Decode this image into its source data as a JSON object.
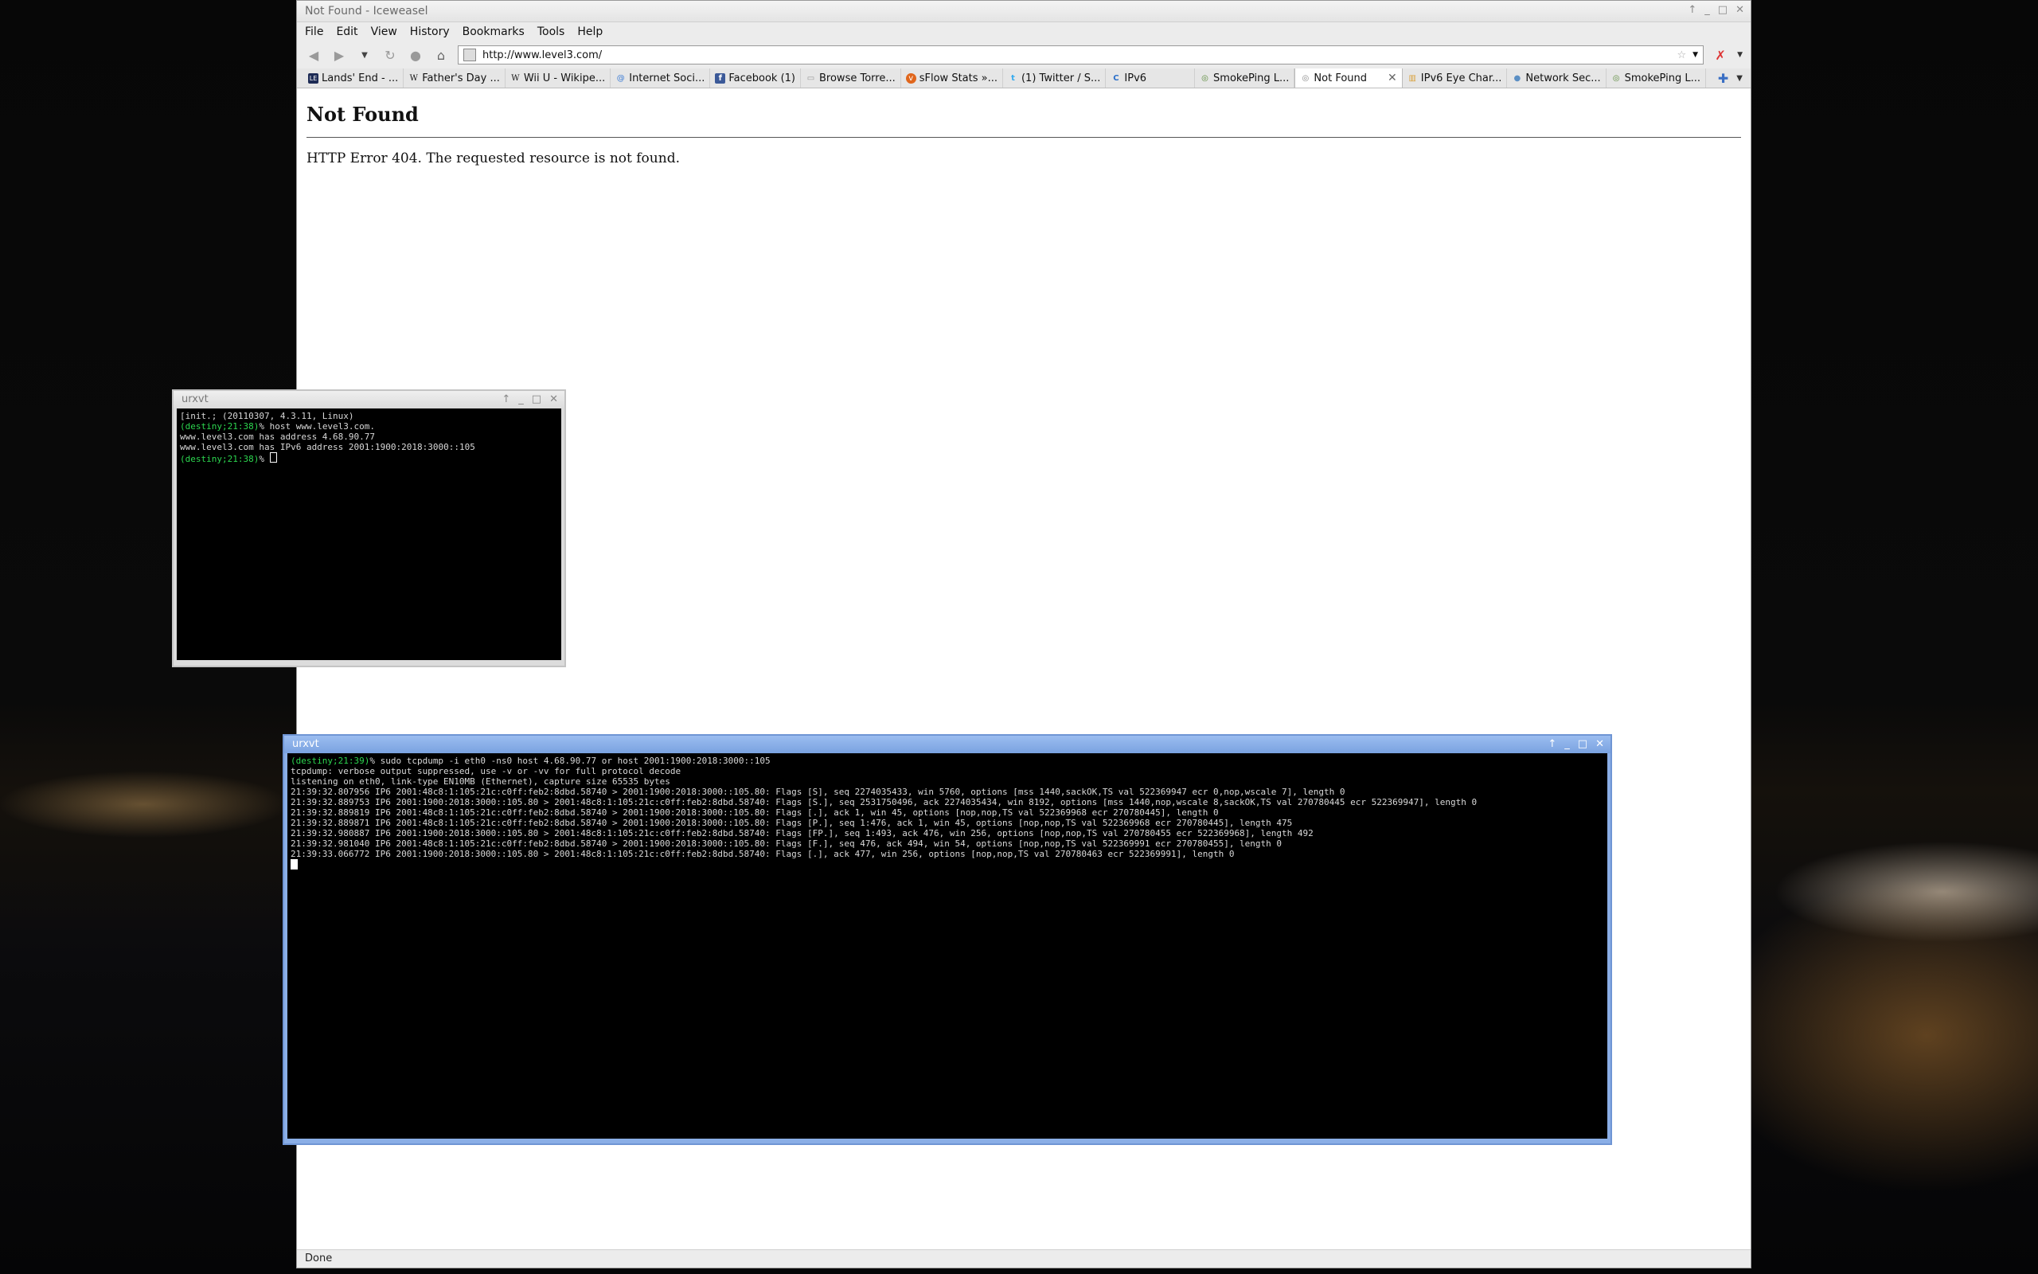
{
  "browser": {
    "window_title": "Not Found - Iceweasel",
    "window_buttons": [
      "↑",
      "_",
      "□",
      "✕"
    ],
    "menu": [
      "File",
      "Edit",
      "View",
      "History",
      "Bookmarks",
      "Tools",
      "Help"
    ],
    "url": "http://www.level3.com/",
    "tabs": [
      {
        "label": "Lands' End - ...",
        "icon": "LE",
        "icon_color": "#1d2b55"
      },
      {
        "label": "Father's Day ...",
        "icon": "W",
        "icon_color": "#ffffff"
      },
      {
        "label": "Wii U - Wikipe...",
        "icon": "W",
        "icon_color": "#ffffff"
      },
      {
        "label": "Internet Soci...",
        "icon": "@",
        "icon_color": "#3a7bd5"
      },
      {
        "label": "Facebook (1)",
        "icon": "f",
        "icon_color": "#3b5998"
      },
      {
        "label": "Browse Torre...",
        "icon": "▭",
        "icon_color": "#dddddd"
      },
      {
        "label": "sFlow Stats »...",
        "icon": "v",
        "icon_color": "#e0661c"
      },
      {
        "label": "(1) Twitter / S...",
        "icon": "t",
        "icon_color": "#33aaee"
      },
      {
        "label": "IPv6",
        "icon": "C",
        "icon_color": "#2a6fc9"
      },
      {
        "label": "SmokePing L...",
        "icon": "◎",
        "icon_color": "#cfe6c0"
      },
      {
        "label": "Not Found",
        "icon": "◎",
        "icon_color": "#dddddd",
        "active": true
      },
      {
        "label": "IPv6 Eye Char...",
        "icon": "▥",
        "icon_color": "#d9a03a"
      },
      {
        "label": "Network Sec...",
        "icon": "●",
        "icon_color": "#5b8fc4"
      },
      {
        "label": "SmokePing L...",
        "icon": "◎",
        "icon_color": "#cfe6c0"
      }
    ],
    "page": {
      "heading": "Not Found",
      "message": "HTTP Error 404. The requested resource is not found."
    },
    "status": "Done"
  },
  "term_small": {
    "title": "urxvt",
    "lines": [
      {
        "text": "[init.; (20110307, 4.3.11, Linux)"
      },
      {
        "prompt": "(destiny;21:38)",
        "text": "% host www.level3.com."
      },
      {
        "text": "www.level3.com has address 4.68.90.77"
      },
      {
        "text": "www.level3.com has IPv6 address 2001:1900:2018:3000::105"
      },
      {
        "prompt": "(destiny;21:38)",
        "text": "% ",
        "cursor": true
      }
    ]
  },
  "term_large": {
    "title": "urxvt",
    "lines": [
      {
        "prompt": "(destiny;21:39)",
        "text": "% sudo tcpdump -i eth0 -ns0 host 4.68.90.77 or host 2001:1900:2018:3000::105"
      },
      {
        "text": "tcpdump: verbose output suppressed, use -v or -vv for full protocol decode"
      },
      {
        "text": "listening on eth0, link-type EN10MB (Ethernet), capture size 65535 bytes"
      },
      {
        "text": "21:39:32.807956 IP6 2001:48c8:1:105:21c:c0ff:feb2:8dbd.58740 > 2001:1900:2018:3000::105.80: Flags [S], seq 2274035433, win 5760, options [mss 1440,sackOK,TS val 522369947 ecr 0,nop,wscale 7], length 0"
      },
      {
        "text": "21:39:32.889753 IP6 2001:1900:2018:3000::105.80 > 2001:48c8:1:105:21c:c0ff:feb2:8dbd.58740: Flags [S.], seq 2531750496, ack 2274035434, win 8192, options [mss 1440,nop,wscale 8,sackOK,TS val 270780445 ecr 522369947], length 0"
      },
      {
        "text": "21:39:32.889819 IP6 2001:48c8:1:105:21c:c0ff:feb2:8dbd.58740 > 2001:1900:2018:3000::105.80: Flags [.], ack 1, win 45, options [nop,nop,TS val 522369968 ecr 270780445], length 0"
      },
      {
        "text": "21:39:32.889871 IP6 2001:48c8:1:105:21c:c0ff:feb2:8dbd.58740 > 2001:1900:2018:3000::105.80: Flags [P.], seq 1:476, ack 1, win 45, options [nop,nop,TS val 522369968 ecr 270780445], length 475"
      },
      {
        "text": "21:39:32.980887 IP6 2001:1900:2018:3000::105.80 > 2001:48c8:1:105:21c:c0ff:feb2:8dbd.58740: Flags [FP.], seq 1:493, ack 476, win 256, options [nop,nop,TS val 270780455 ecr 522369968], length 492"
      },
      {
        "text": "21:39:32.981040 IP6 2001:48c8:1:105:21c:c0ff:feb2:8dbd.58740 > 2001:1900:2018:3000::105.80: Flags [F.], seq 476, ack 494, win 54, options [nop,nop,TS val 522369991 ecr 270780455], length 0"
      },
      {
        "text": "21:39:33.066772 IP6 2001:1900:2018:3000::105.80 > 2001:48c8:1:105:21c:c0ff:feb2:8dbd.58740: Flags [.], ack 477, win 256, options [nop,nop,TS val 270780463 ecr 522369991], length 0"
      },
      {
        "text": "",
        "cursor": true,
        "solid": true
      }
    ]
  }
}
